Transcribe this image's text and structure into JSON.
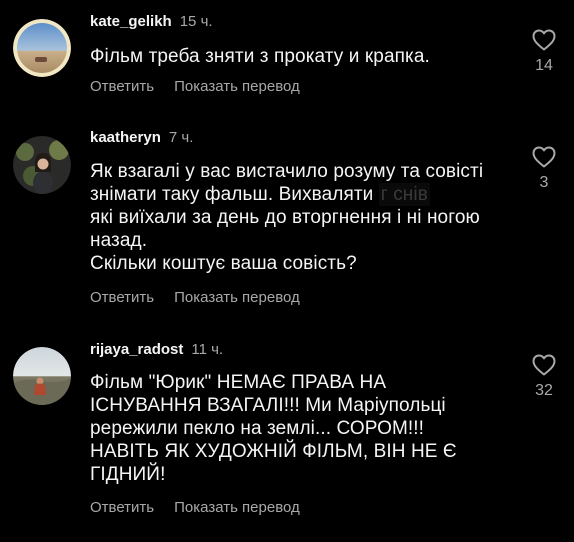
{
  "comments": [
    {
      "username": "kate_gelikh",
      "time": "15 ч.",
      "text": "Фільм треба зняти з прокату и крапка.",
      "reply_label": "Ответить",
      "translate_label": "Показать перевод",
      "likes": "14",
      "avatar_icon": "avatar-landscape-photo"
    },
    {
      "username": "kaatheryn",
      "time": "7 ч.",
      "text_line1": "Як взагалі у вас вистачило розуму та совісті",
      "text_line2a": "знімати таку фальш. Вихваляти ",
      "text_redacted": "г     снів",
      "text_line3": "які виїхали за день до вторгнення і ні ногою",
      "text_line4": "назад.",
      "text_line5": "Скільки коштує ваша совість?",
      "reply_label": "Ответить",
      "translate_label": "Показать перевод",
      "likes": "3",
      "avatar_icon": "avatar-person-photo"
    },
    {
      "username": "rijaya_radost",
      "time": "11 ч.",
      "text": "Фільм \"Юрик\" НЕМАЄ ПРАВА НА\nІСНУВАННЯ ВЗАГАЛІ!!! Ми Маріупольці\npережили пекло на землі... СОРОМ!!!\nНАВІТЬ ЯК ХУДОЖНІЙ ФІЛЬМ, ВІН НЕ Є\nГІДНИЙ!",
      "reply_label": "Ответить",
      "translate_label": "Показать перевод",
      "likes": "32",
      "avatar_icon": "avatar-outdoor-photo"
    }
  ],
  "colors": {
    "background": "#000000",
    "primary_text": "#f5f5f5",
    "secondary_text": "#a8a8a8"
  },
  "icons": {
    "like": "heart-outline-icon"
  }
}
